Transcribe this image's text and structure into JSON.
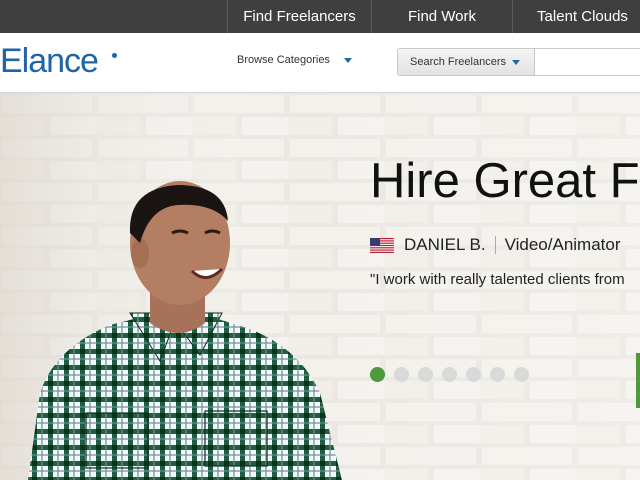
{
  "topnav": {
    "items": [
      {
        "label": "Find Freelancers"
      },
      {
        "label": "Find Work"
      },
      {
        "label": "Talent Clouds"
      }
    ]
  },
  "header": {
    "logo_text": "Elance",
    "browse_label": "Browse Categories",
    "search": {
      "type_label": "Search Freelancers",
      "placeholder": ""
    }
  },
  "hero": {
    "headline": "Hire Great F",
    "freelancer_name": "DANIEL B.",
    "freelancer_role": "Video/Animator",
    "quote": "\"I work with really talented clients from",
    "carousel": {
      "total": 7,
      "active_index": 0
    },
    "colors": {
      "active_dot": "#4f9a3a",
      "inactive_dot": "#d9d9d9",
      "brand": "#1f63a8"
    }
  }
}
